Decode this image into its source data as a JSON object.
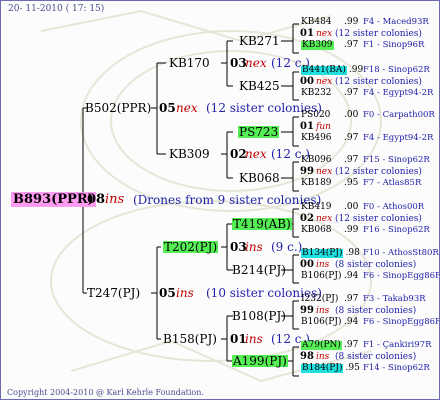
{
  "header": {
    "date": "20- 11-2010 ( 17: 15)"
  },
  "footer": {
    "copyright": "Copyright 2004-2010 @ Karl Kehrle Foundation."
  },
  "root": {
    "id": "B893(PPR)",
    "count": "08",
    "word": "ins",
    "note": "(Drones from 9 sister colonies)"
  },
  "g1": [
    {
      "id": "B502(PPR)",
      "count": "05",
      "word": "nex",
      "note": "(12 sister colonies)"
    },
    {
      "id": "T247(PJ)",
      "count": "05",
      "word": "ins",
      "note": "(10 sister colonies)"
    }
  ],
  "g2": [
    {
      "id": "KB170",
      "count": "03",
      "word": "nex",
      "note": "(12 c.)"
    },
    {
      "id": "KB309",
      "count": "02",
      "word": "nex",
      "note": "(12 c.)"
    },
    {
      "id": "T202(PJ)",
      "count": "03",
      "word": "ins",
      "note": "(9 c.)"
    },
    {
      "id": "B158(PJ)",
      "count": "01",
      "word": "ins",
      "note": "(12 c.)"
    }
  ],
  "g3": [
    "KB271",
    "KB425",
    "PS723",
    "KB068",
    "T419(AB)",
    "B214(PJ)",
    "B108(PJ)",
    "A199(PJ)"
  ],
  "g4": [
    {
      "top": {
        "id": "KB484",
        "yr": ".99",
        "origin": "F4 - Maced93R"
      },
      "mid": {
        "count": "01",
        "word": "nex",
        "note": "(12 sister colonies)"
      },
      "bot": {
        "id": "KB309",
        "yr": ".97",
        "origin": "F1 - Sinop96R"
      }
    },
    {
      "top": {
        "id": "B441(BA)",
        "yr": ".99",
        "origin": "F18 - Sinop62R"
      },
      "mid": {
        "count": "00",
        "word": "nex",
        "note": "(12 sister colonies)"
      },
      "bot": {
        "id": "KB232",
        "yr": ".97",
        "origin": "F4 - Egypt94-2R"
      }
    },
    {
      "top": {
        "id": "PS020",
        "yr": ".00",
        "origin": "F0 - Carpath00R"
      },
      "mid": {
        "count": "01",
        "word": "fun",
        "note": ""
      },
      "bot": {
        "id": "KB496",
        "yr": ".97",
        "origin": "F4 - Egypt94-2R"
      }
    },
    {
      "top": {
        "id": "KB096",
        "yr": ".97",
        "origin": "F15 - Sinop62R"
      },
      "mid": {
        "count": "99",
        "word": "nex",
        "note": "(12 sister colonies)"
      },
      "bot": {
        "id": "KB189",
        "yr": ".95",
        "origin": "F7 - Atlas85R"
      }
    },
    {
      "top": {
        "id": "KB419",
        "yr": ".00",
        "origin": "F0 - Athos00R"
      },
      "mid": {
        "count": "02",
        "word": "nex",
        "note": "(12 sister colonies)"
      },
      "bot": {
        "id": "KB068",
        "yr": ".99",
        "origin": "F16 - Sinop62R"
      }
    },
    {
      "top": {
        "id": "B134(PJ)",
        "yr": ".98",
        "origin": "F10 - AthosSt80R"
      },
      "mid": {
        "count": "00",
        "word": "ins",
        "note": "(8 sister colonies)"
      },
      "bot": {
        "id": "B106(PJ)",
        "yr": ".94",
        "origin": "F6 - SinopEgg86R"
      }
    },
    {
      "top": {
        "id": "I232(PJ)",
        "yr": ".97",
        "origin": "F3 - Takab93R"
      },
      "mid": {
        "count": "99",
        "word": "ins",
        "note": "(8 sister colonies)"
      },
      "bot": {
        "id": "B106(PJ)",
        "yr": ".94",
        "origin": "F6 - SinopEgg86R"
      }
    },
    {
      "top": {
        "id": "A79(PN)",
        "yr": ".97",
        "origin": "F1 - Çankiri97R"
      },
      "mid": {
        "count": "98",
        "word": "ins",
        "note": "(8 sister colonies)"
      },
      "bot": {
        "id": "B184(PJ)",
        "yr": ".95",
        "origin": "F14 - Sinop62R"
      }
    }
  ],
  "colors": {
    "highlight_green": "#55ee55",
    "highlight_cyan": "#22e0e0",
    "highlight_pink": "#ff9cf2",
    "origin_blue": "#2222aa",
    "mating_red": "#c00000"
  }
}
